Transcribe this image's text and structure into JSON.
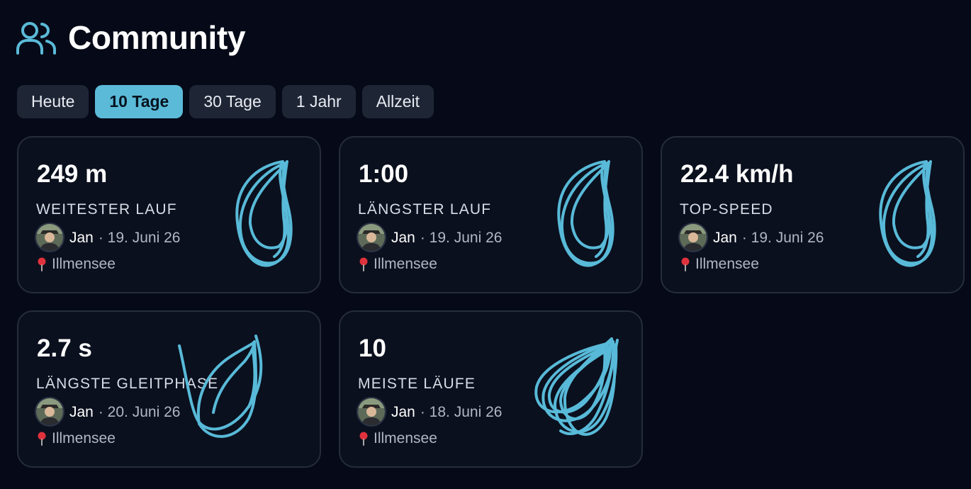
{
  "header": {
    "title": "Community",
    "icon": "users-icon"
  },
  "tabs": [
    {
      "label": "Heute",
      "active": false
    },
    {
      "label": "10 Tage",
      "active": true
    },
    {
      "label": "30 Tage",
      "active": false
    },
    {
      "label": "1 Jahr",
      "active": false
    },
    {
      "label": "Allzeit",
      "active": false
    }
  ],
  "cards": [
    {
      "value": "249 m",
      "label": "WEITESTER LAUF",
      "user": "Jan",
      "date": "· 19. Juni 26",
      "location": "Illmensee"
    },
    {
      "value": "1:00",
      "label": "LÄNGSTER LAUF",
      "user": "Jan",
      "date": "· 19. Juni 26",
      "location": "Illmensee"
    },
    {
      "value": "22.4 km/h",
      "label": "TOP-SPEED",
      "user": "Jan",
      "date": "· 19. Juni 26",
      "location": "Illmensee"
    },
    {
      "value": "2.7 s",
      "label": "LÄNGSTE GLEITPHASE",
      "user": "Jan",
      "date": "· 20. Juni 26",
      "location": "Illmensee"
    },
    {
      "value": "10",
      "label": "MEISTE LÄUFE",
      "user": "Jan",
      "date": "· 18. Juni 26",
      "location": "Illmensee"
    }
  ],
  "colors": {
    "accent": "#5bbad8",
    "background": "#060a18",
    "card": "#0b101e",
    "route": "#58bad8",
    "pin": "#e0323c"
  }
}
